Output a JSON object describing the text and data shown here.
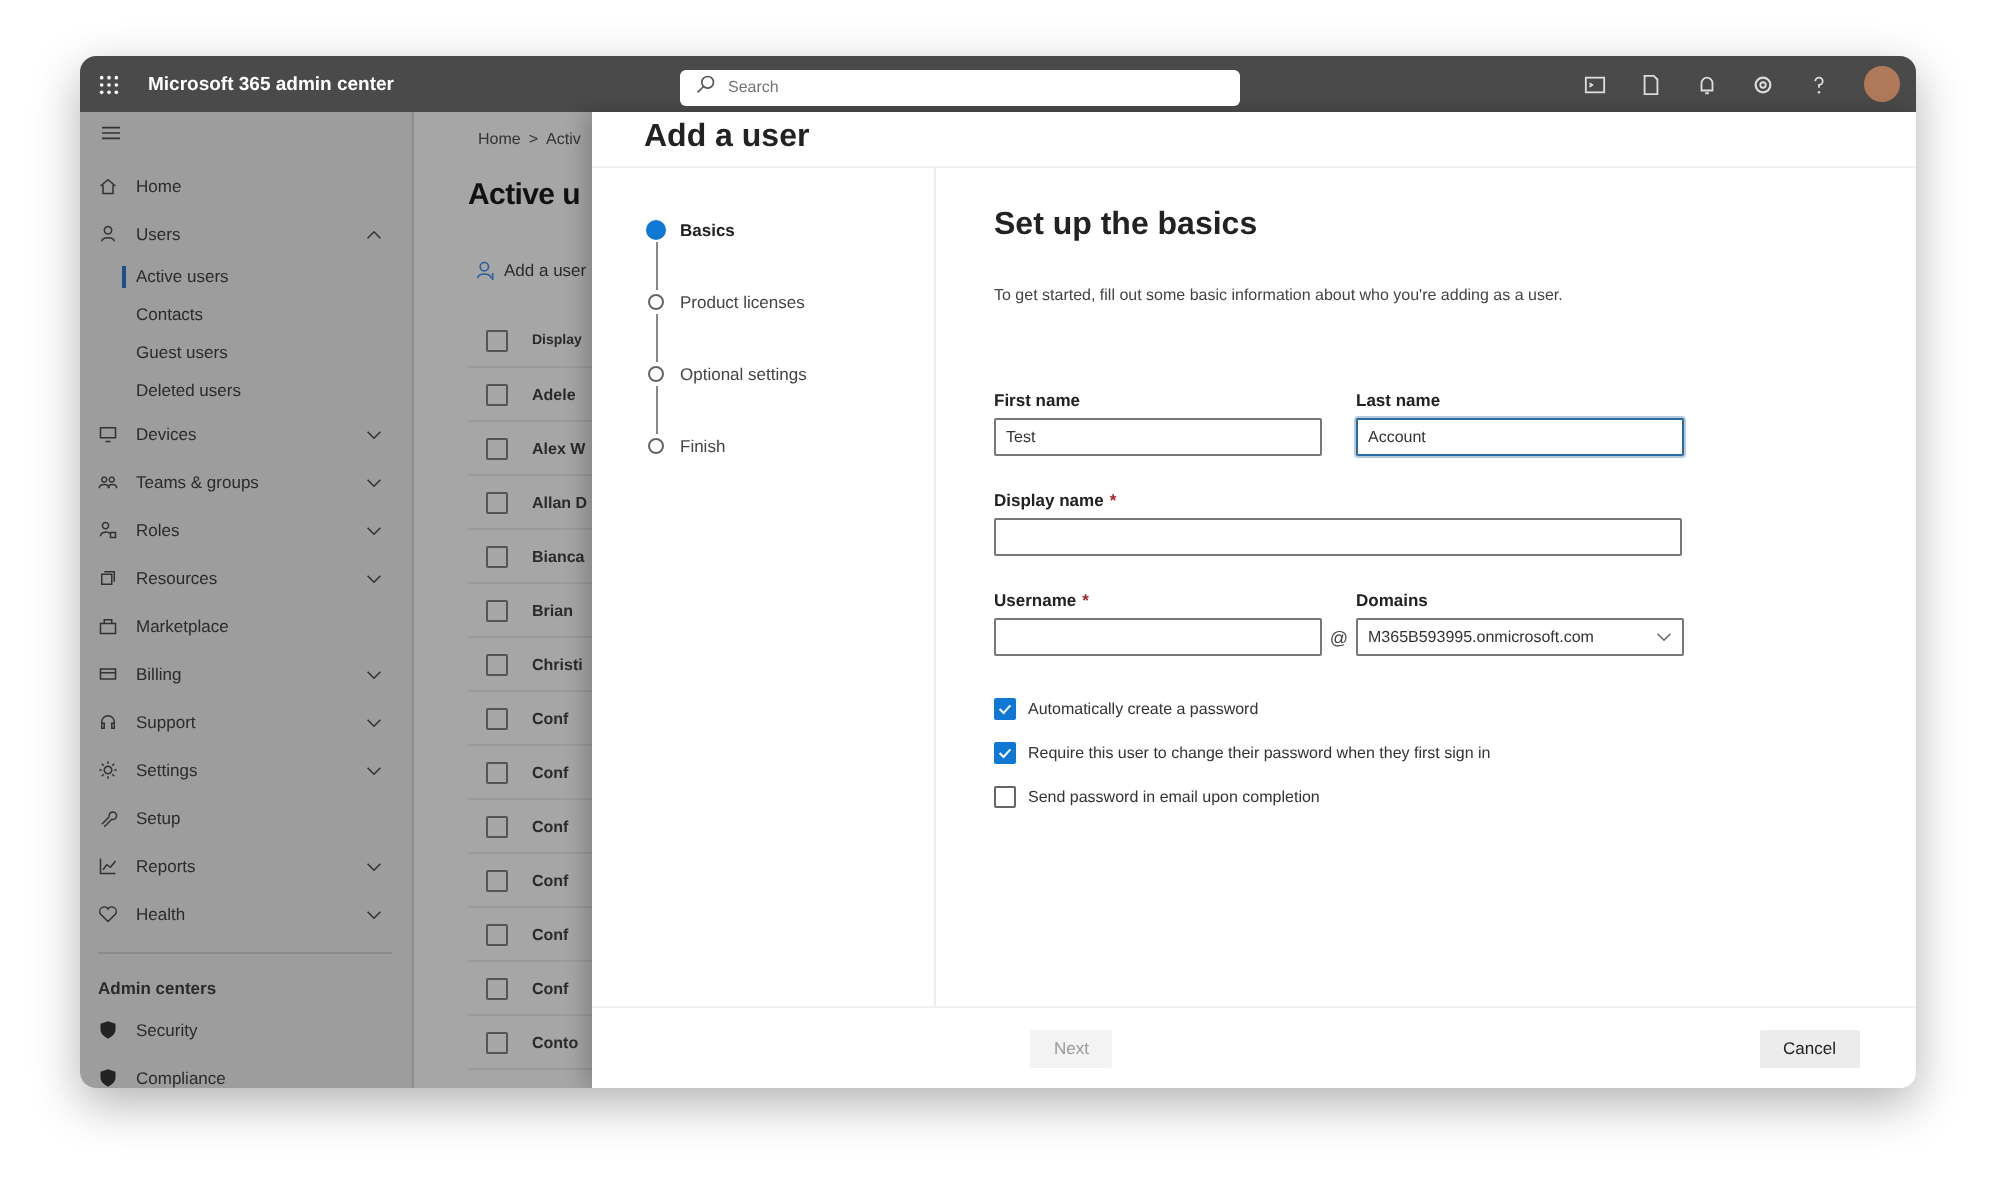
{
  "topbar": {
    "app_title": "Microsoft 365 admin center",
    "search": {
      "placeholder": "Search"
    }
  },
  "nav": {
    "items": [
      {
        "label": "Home"
      },
      {
        "label": "Users",
        "expanded": true,
        "children": [
          {
            "label": "Active users",
            "selected": true
          },
          {
            "label": "Contacts",
            "selected": false
          },
          {
            "label": "Guest users",
            "selected": false
          },
          {
            "label": "Deleted users",
            "selected": false
          }
        ]
      },
      {
        "label": "Devices",
        "expanded": false
      },
      {
        "label": "Teams & groups",
        "expanded": false
      },
      {
        "label": "Roles",
        "expanded": false
      },
      {
        "label": "Resources",
        "expanded": false
      },
      {
        "label": "Marketplace"
      },
      {
        "label": "Billing",
        "expanded": false
      },
      {
        "label": "Support",
        "expanded": false
      },
      {
        "label": "Settings",
        "expanded": false
      },
      {
        "label": "Setup"
      },
      {
        "label": "Reports",
        "expanded": false
      },
      {
        "label": "Health",
        "expanded": false
      }
    ],
    "section_title": "Admin centers",
    "admin_centers": [
      {
        "label": "Security"
      },
      {
        "label": "Compliance"
      }
    ]
  },
  "page": {
    "breadcrumb": [
      "Home",
      ">",
      "Activ"
    ],
    "title": "Active u",
    "toolbar_action": "Add a user",
    "table": {
      "column_header": "Display",
      "header_checked": false,
      "rows": [
        {
          "name": "Adele",
          "checked": false
        },
        {
          "name": "Alex W",
          "checked": false
        },
        {
          "name": "Allan D",
          "checked": false
        },
        {
          "name": "Bianca",
          "checked": false
        },
        {
          "name": "Brian",
          "checked": false
        },
        {
          "name": "Christi",
          "checked": false
        },
        {
          "name": "Conf",
          "checked": false
        },
        {
          "name": "Conf",
          "checked": false
        },
        {
          "name": "Conf",
          "checked": false
        },
        {
          "name": "Conf",
          "checked": false
        },
        {
          "name": "Conf",
          "checked": false
        },
        {
          "name": "Conf",
          "checked": false
        },
        {
          "name": "Conto",
          "checked": false
        }
      ]
    }
  },
  "panel": {
    "title": "Add a user",
    "steps": [
      {
        "label": "Basics",
        "selected": true
      },
      {
        "label": "Product licenses",
        "selected": false
      },
      {
        "label": "Optional settings",
        "selected": false
      },
      {
        "label": "Finish",
        "selected": false
      }
    ],
    "heading": "Set up the basics",
    "intro": "To get started, fill out some basic information about who you're adding as a user.",
    "first_name": {
      "label": "First name",
      "value": "Test",
      "focused": false
    },
    "last_name": {
      "label": "Last name",
      "value": "Account",
      "focused": true
    },
    "display_name": {
      "label": "Display name",
      "required_mark": "*",
      "focused": false
    },
    "username": {
      "label": "Username",
      "required_mark": "*",
      "focused": false
    },
    "at_sign": "@",
    "domains": {
      "label": "Domains",
      "value": "M365B593995.onmicrosoft.com"
    },
    "checkboxes": [
      {
        "label": "Automatically create a password",
        "checked": true
      },
      {
        "label": "Require this user to change their password when they first sign in",
        "checked": true
      },
      {
        "label": "Send password in email upon completion",
        "checked": false
      }
    ],
    "buttons": [
      {
        "label": "Next",
        "disabled": true
      },
      {
        "label": "Cancel",
        "disabled": false
      }
    ]
  }
}
